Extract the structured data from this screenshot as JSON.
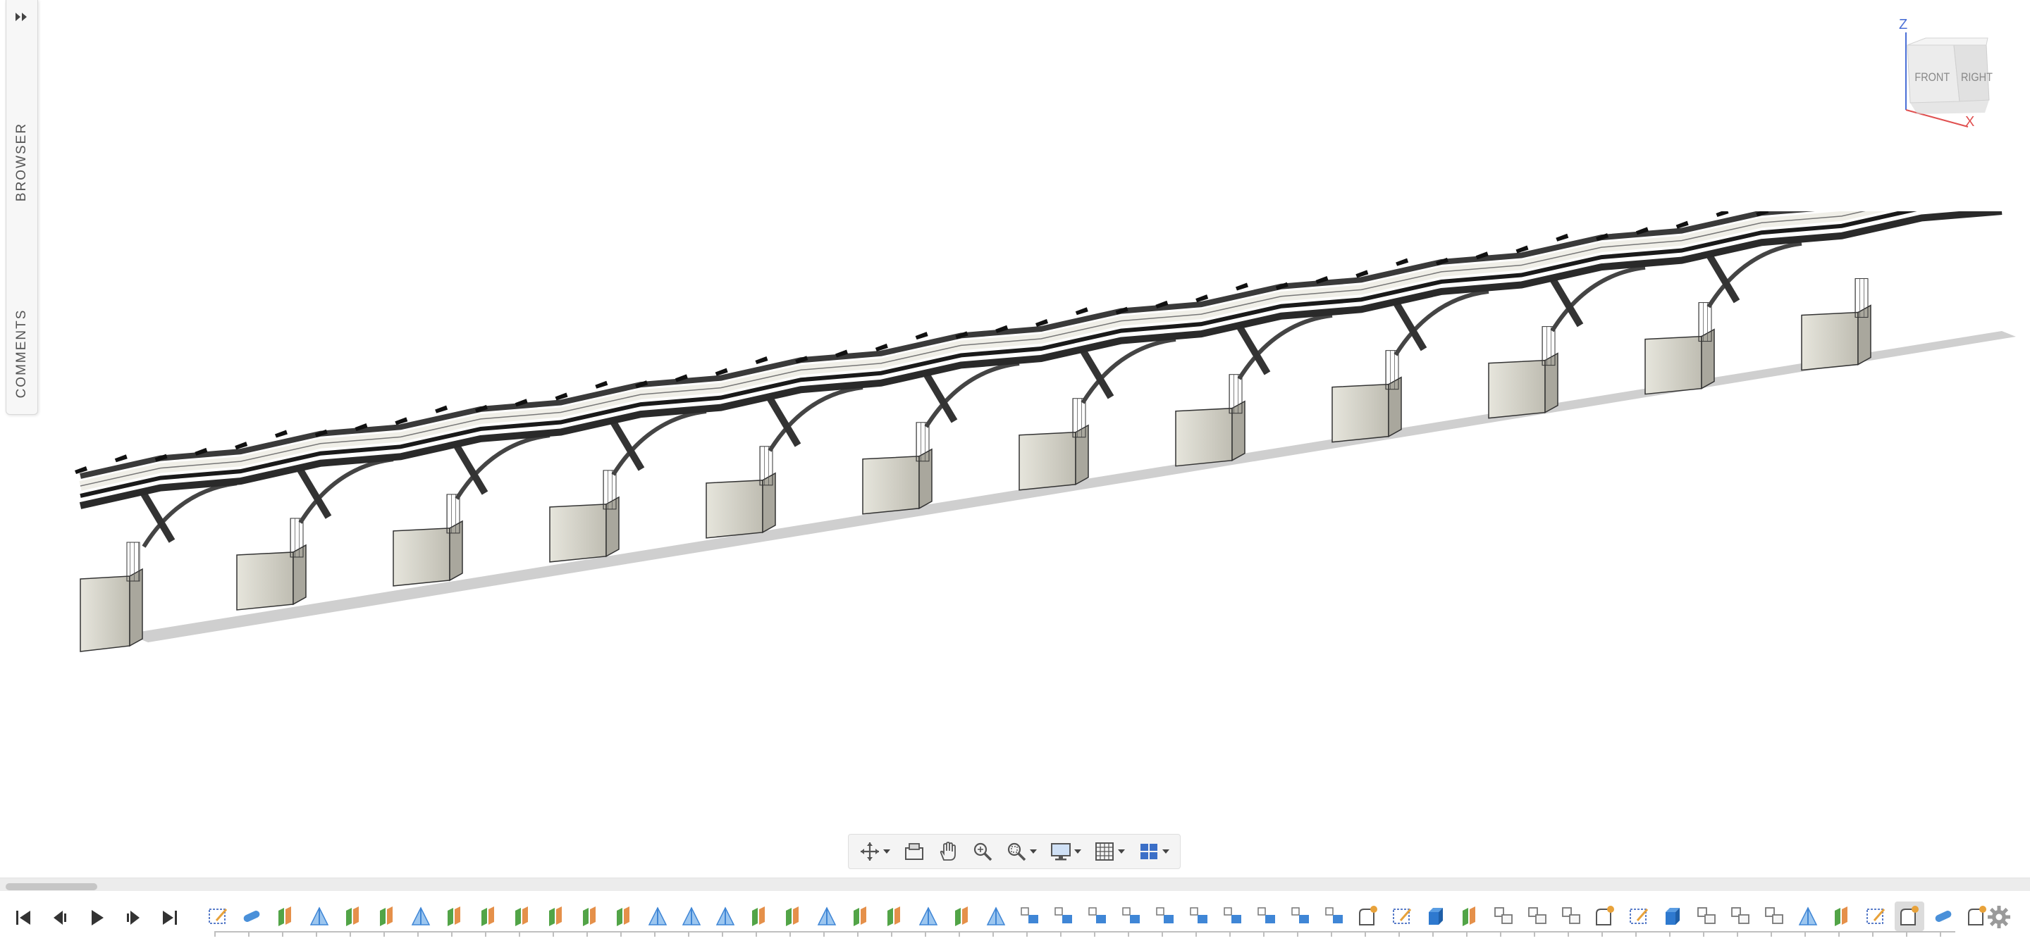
{
  "panel": {
    "browser_label": "BROWSER",
    "comments_label": "COMMENTS",
    "expand_icon": "double-chevron-right-icon"
  },
  "viewcube": {
    "front_label": "FRONT",
    "right_label": "RIGHT",
    "z_label": "Z",
    "x_label": "X",
    "z_color": "#4a6fd6",
    "x_color": "#e05050"
  },
  "model": {
    "description_hidden": "",
    "pier_count": 12,
    "span_count": 24
  },
  "nav_toolbar": {
    "items": [
      {
        "icon": "orbit-icon",
        "dropdown": true
      },
      {
        "icon": "look-at-icon",
        "dropdown": false
      },
      {
        "icon": "pan-hand-icon",
        "dropdown": false
      },
      {
        "icon": "zoom-icon",
        "dropdown": false
      },
      {
        "icon": "fit-window-icon",
        "dropdown": true
      },
      {
        "icon": "display-settings-icon",
        "dropdown": true
      },
      {
        "icon": "grid-snap-icon",
        "dropdown": true
      },
      {
        "icon": "viewports-icon",
        "dropdown": true
      }
    ]
  },
  "timeline": {
    "playback": [
      "skip-to-start-icon",
      "step-back-icon",
      "play-icon",
      "step-forward-icon",
      "skip-to-end-icon"
    ],
    "features": [
      "sketch",
      "extrude-body",
      "plane-green",
      "mirror-blue",
      "plane-green",
      "plane-green",
      "mirror-blue",
      "plane-green",
      "plane-green",
      "plane-green",
      "plane-green",
      "plane-green",
      "plane-green",
      "mirror-blue",
      "mirror-blue",
      "mirror-blue",
      "plane-green",
      "plane-green",
      "mirror-blue",
      "plane-green",
      "plane-green",
      "mirror-blue",
      "plane-green",
      "mirror-blue",
      "pattern-blue",
      "pattern-blue",
      "pattern-blue",
      "pattern-blue",
      "pattern-blue",
      "pattern-blue",
      "pattern-blue",
      "pattern-blue",
      "pattern-blue",
      "pattern-blue",
      "fillet-orange",
      "sketch",
      "box-blue",
      "plane-green",
      "pattern-gray",
      "pattern-gray",
      "pattern-gray",
      "fillet-orange",
      "sketch",
      "box-blue",
      "pattern-gray",
      "pattern-gray",
      "pattern-gray",
      "mirror-blue",
      "plane-green",
      "sketch",
      "fillet-orange",
      "extrude-body",
      "fillet-orange"
    ],
    "active_index": 50,
    "settings_icon": "gear-icon"
  }
}
